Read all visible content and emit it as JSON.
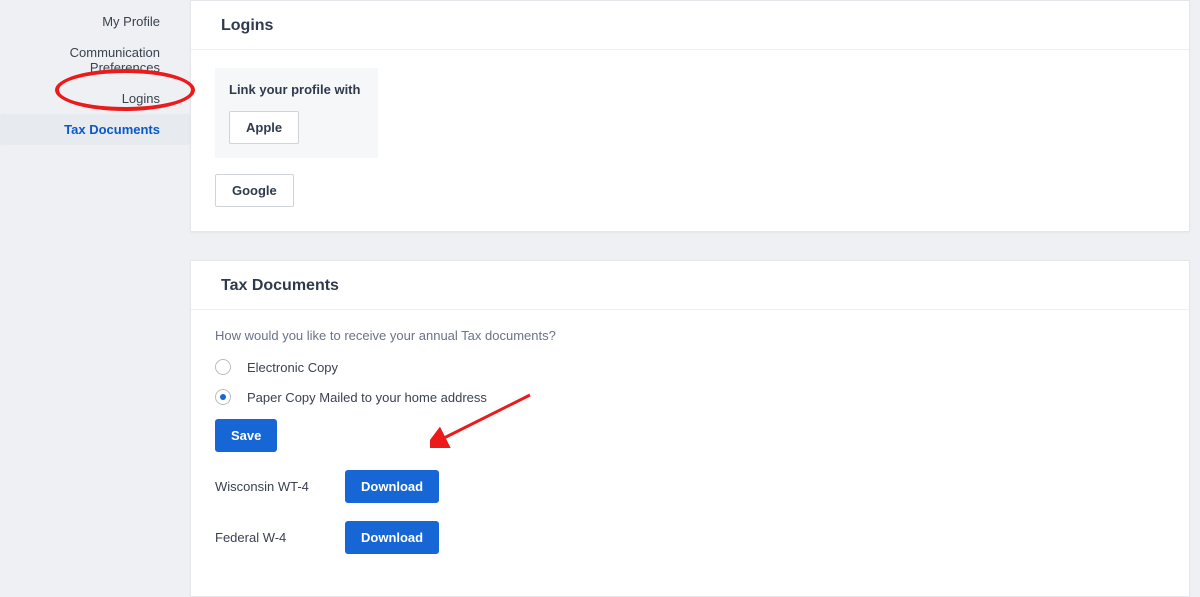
{
  "sidebar": {
    "items": [
      {
        "label": "My Profile"
      },
      {
        "label": "Communication Preferences"
      },
      {
        "label": "Logins"
      },
      {
        "label": "Tax Documents"
      }
    ]
  },
  "logins": {
    "title": "Logins",
    "link_title": "Link your profile with",
    "buttons": {
      "apple": "Apple",
      "google": "Google"
    }
  },
  "tax": {
    "title": "Tax Documents",
    "question": "How would you like to receive your annual Tax documents?",
    "option_electronic": "Electronic Copy",
    "option_paper": "Paper Copy Mailed to your home address",
    "save": "Save",
    "docs": [
      {
        "label": "Wisconsin WT-4",
        "action": "Download"
      },
      {
        "label": "Federal W-4",
        "action": "Download"
      }
    ]
  }
}
